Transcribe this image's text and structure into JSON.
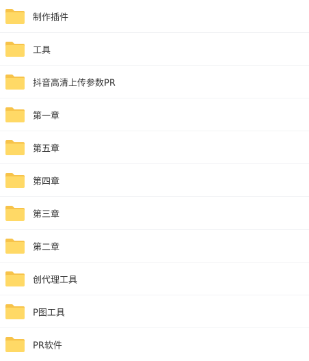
{
  "folders": [
    {
      "name": "制作插件",
      "icon": "folder-icon"
    },
    {
      "name": "工具",
      "icon": "folder-icon"
    },
    {
      "name": "抖音高清上传参数PR",
      "icon": "folder-icon"
    },
    {
      "name": "第一章",
      "icon": "folder-icon"
    },
    {
      "name": "第五章",
      "icon": "folder-icon"
    },
    {
      "name": "第四章",
      "icon": "folder-icon"
    },
    {
      "name": "第三章",
      "icon": "folder-icon"
    },
    {
      "name": "第二章",
      "icon": "folder-icon"
    },
    {
      "name": "创代理工具",
      "icon": "folder-icon"
    },
    {
      "name": "P图工具",
      "icon": "folder-icon"
    },
    {
      "name": "PR软件",
      "icon": "folder-icon"
    }
  ],
  "colors": {
    "folder_back": "#f7c34a",
    "folder_front": "#ffd966",
    "text": "#333333",
    "divider": "#f2f3f5"
  }
}
